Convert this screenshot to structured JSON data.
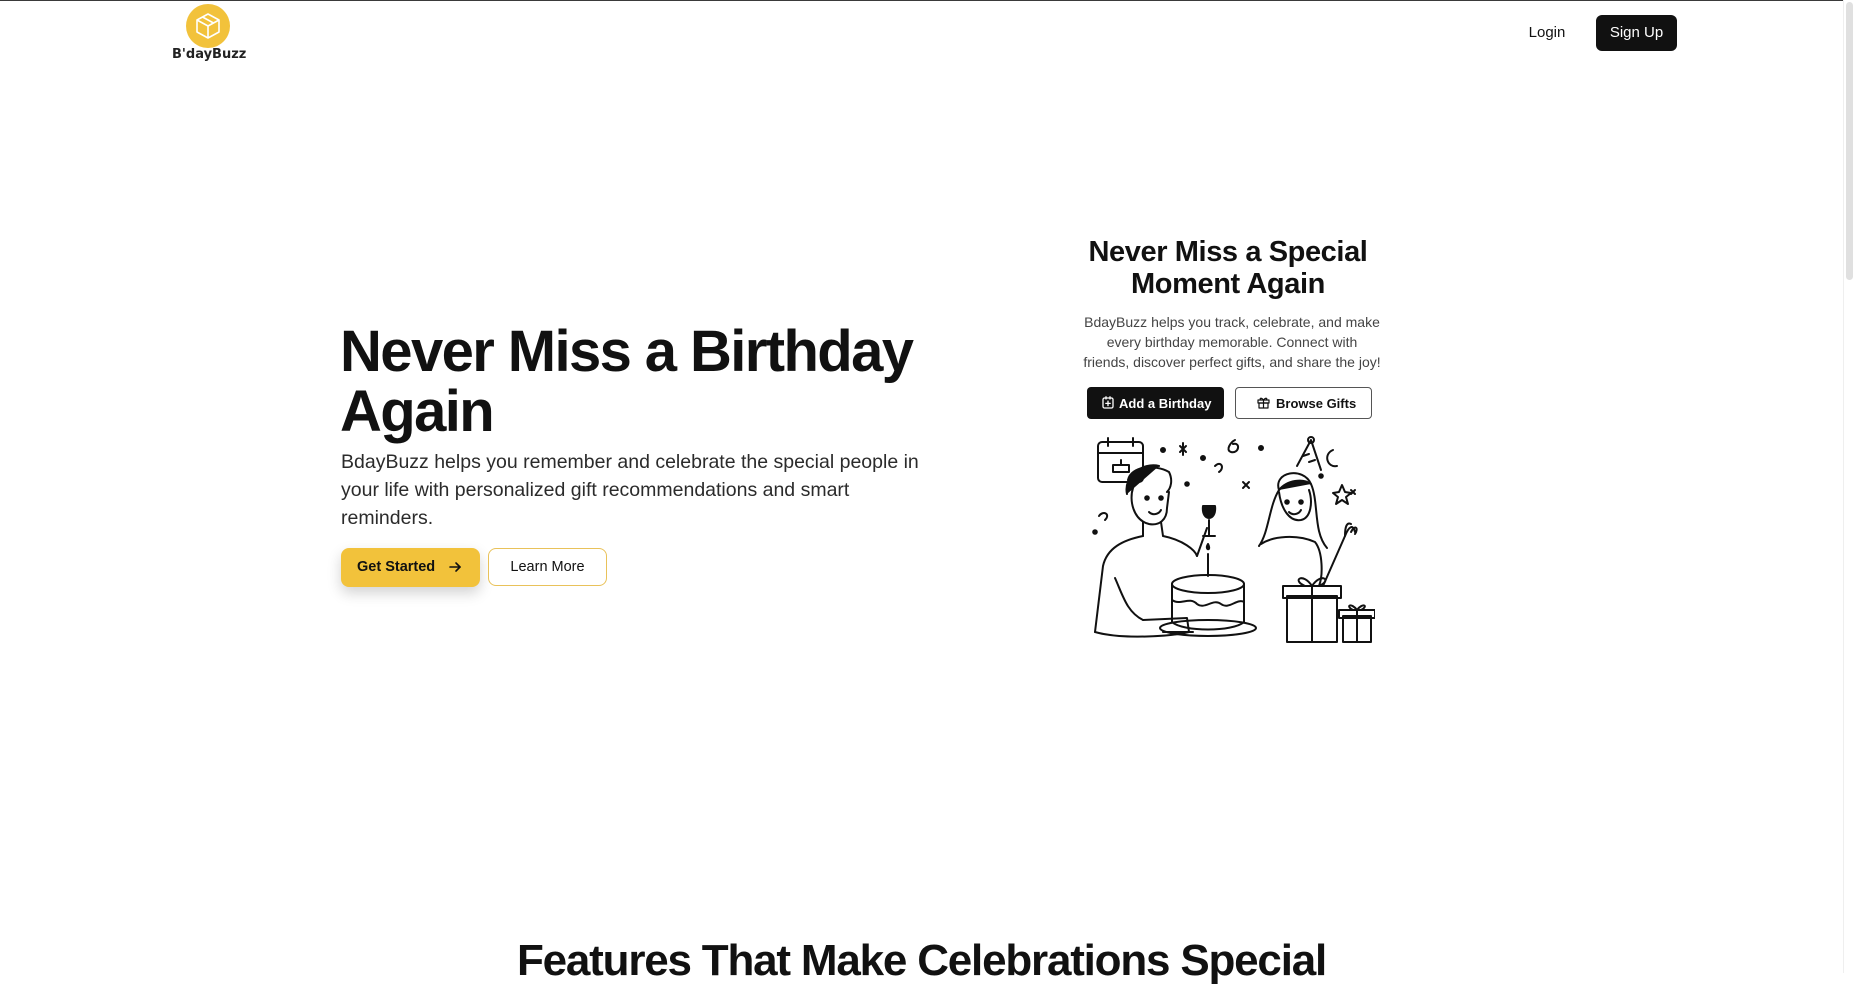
{
  "brand": {
    "name": "B'dayBuzz",
    "accent": "#f2c23b",
    "dark": "#111111",
    "logo_icon": "box-icon"
  },
  "nav": {
    "login_label": "Login",
    "signup_label": "Sign Up"
  },
  "hero": {
    "title": "Never Miss a Birthday Again",
    "subtitle": "BdayBuzz helps you remember and celebrate the special people in your life with personalized gift recommendations and smart reminders.",
    "primary_cta": "Get Started",
    "primary_cta_icon": "arrow-right-icon",
    "secondary_cta": "Learn More"
  },
  "card": {
    "title": "Never Miss a Special Moment Again",
    "text": "BdayBuzz helps you track, celebrate, and make every birthday memorable. Connect with friends, discover perfect gifts, and share the joy!",
    "add_button": "Add a Birthday",
    "add_button_icon": "calendar-plus-icon",
    "browse_button": "Browse Gifts",
    "browse_button_icon": "gift-icon",
    "illustration": "birthday-party-illustration"
  },
  "features": {
    "title": "Features That Make Celebrations Special"
  }
}
